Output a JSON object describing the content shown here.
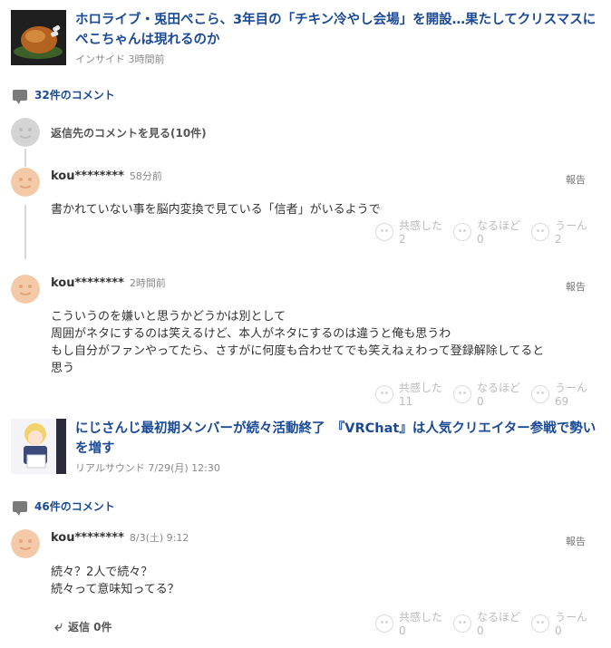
{
  "articles": [
    {
      "title": "ホロライブ・兎田ぺこら、3年目の「チキン冷やし会場」を開設…果たしてクリスマスにぺこちゃんは現れるのか",
      "meta": "インサイド 3時間前",
      "comment_count": "32件のコメント"
    },
    {
      "title": "にじさんじ最初期メンバーが続々活動終了　『VRChat』は人気クリエイター参戦で勢いを増す",
      "meta": "リアルサウンド 7/29(月) 12:30",
      "comment_count": "46件のコメント"
    }
  ],
  "replies_link": "返信先のコメントを見る(10件)",
  "comments": [
    {
      "user": "kou********",
      "time": "58分前",
      "report": "報告",
      "lines": [
        "書かれていない事を脳内変換で見ている「信者」がいるようで"
      ],
      "reactions": [
        {
          "label": "共感した",
          "count": "2"
        },
        {
          "label": "なるほど",
          "count": "0"
        },
        {
          "label": "うーん",
          "count": "2"
        }
      ]
    },
    {
      "user": "kou********",
      "time": "2時間前",
      "report": "報告",
      "lines": [
        "こういうのを嫌いと思うかどうかは別として",
        "周囲がネタにするのは笑えるけど、本人がネタにするのは違うと俺も思うわ",
        "もし自分がファンやってたら、さすがに何度も合わせてでも笑えねぇわって登録解除してると",
        "思う"
      ],
      "reactions": [
        {
          "label": "共感した",
          "count": "11"
        },
        {
          "label": "なるほど",
          "count": "0"
        },
        {
          "label": "うーん",
          "count": "69"
        }
      ]
    },
    {
      "user": "kou********",
      "time": "8/3(土) 9:12",
      "report": "報告",
      "lines": [
        "続々？2人で続々？",
        "続々って意味知ってる？"
      ],
      "reactions": [
        {
          "label": "共感した",
          "count": "0"
        },
        {
          "label": "なるほど",
          "count": "0"
        },
        {
          "label": "うーん",
          "count": "0"
        }
      ]
    }
  ],
  "reply_button": "返信 0件",
  "colors": {
    "link": "#1a4a96",
    "avatar_bg": "#f3c9a8",
    "avatar_grey": "#d4d4d4"
  }
}
